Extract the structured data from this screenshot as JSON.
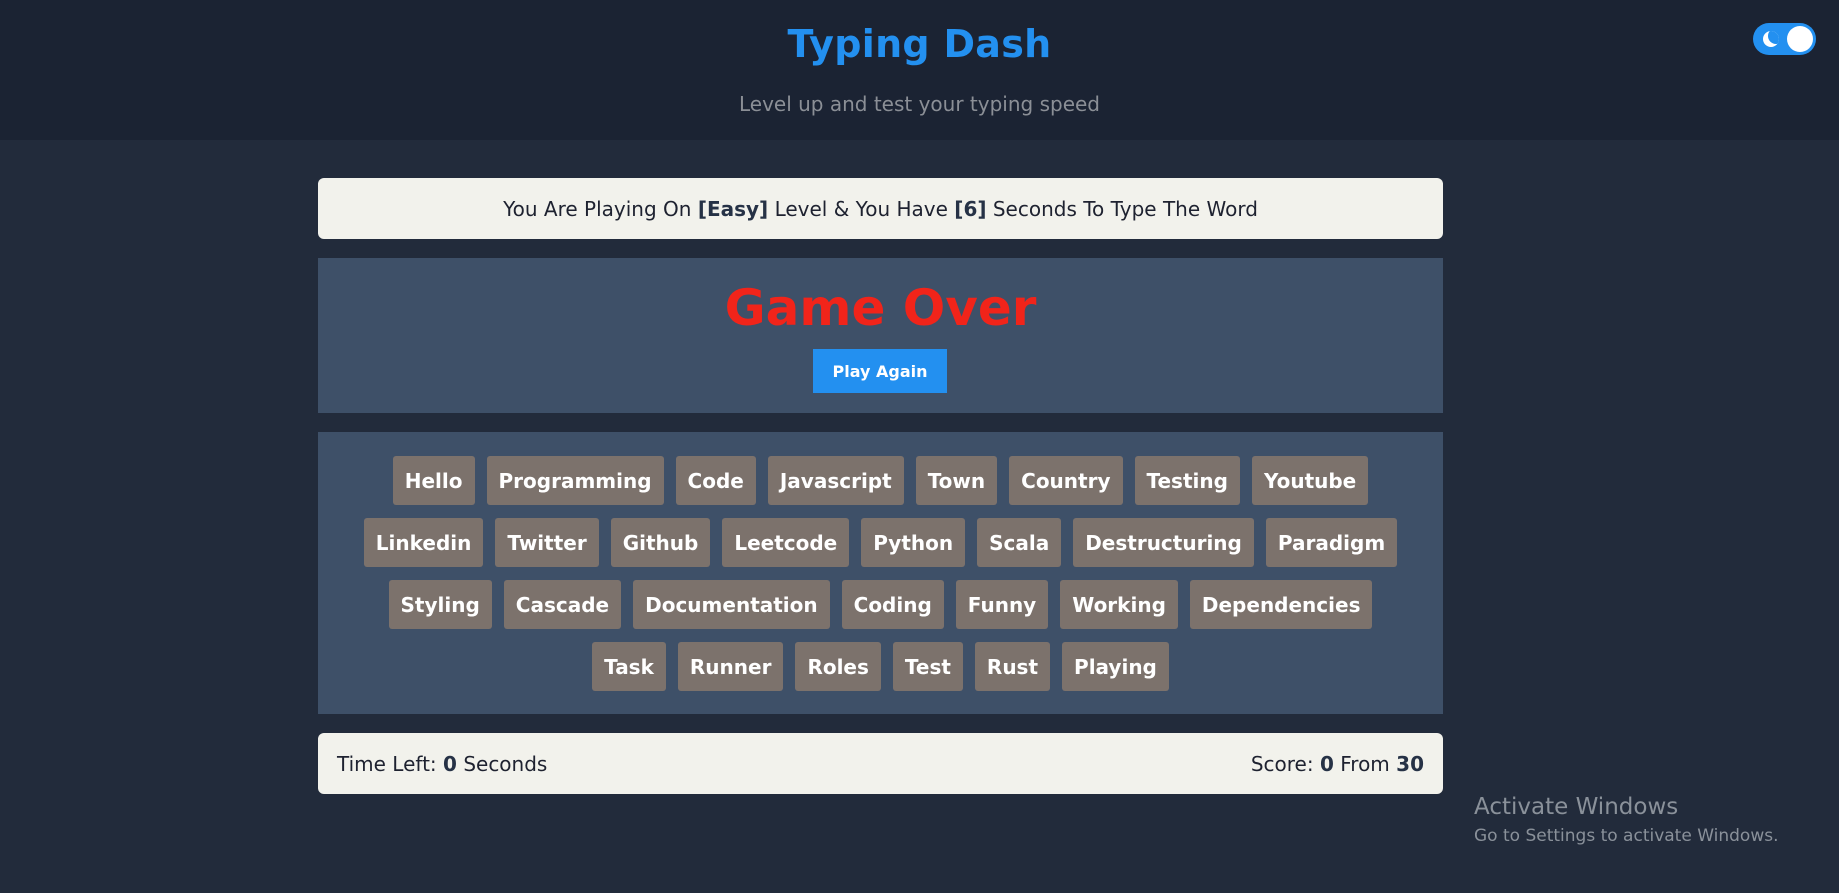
{
  "header": {
    "title": "Typing Dash",
    "subtitle": "Level up and test your typing speed"
  },
  "theme_toggle": {
    "icon": "moon-icon",
    "state": "on",
    "color": "#2390f0"
  },
  "message": {
    "prefix": "You Are Playing On",
    "level": "[Easy]",
    "middle": "Level & You Have",
    "seconds": "[6]",
    "suffix": "Seconds To Type The Word"
  },
  "game": {
    "status": "Game Over",
    "status_color": "#f1241a",
    "play_again_label": "Play Again"
  },
  "words": [
    "Hello",
    "Programming",
    "Code",
    "Javascript",
    "Town",
    "Country",
    "Testing",
    "Youtube",
    "Linkedin",
    "Twitter",
    "Github",
    "Leetcode",
    "Python",
    "Scala",
    "Destructuring",
    "Paradigm",
    "Styling",
    "Cascade",
    "Documentation",
    "Coding",
    "Funny",
    "Working",
    "Dependencies",
    "Task",
    "Runner",
    "Roles",
    "Test",
    "Rust",
    "Playing"
  ],
  "control": {
    "time_label": "Time Left:",
    "time_value": "0",
    "time_unit": "Seconds",
    "score_label": "Score:",
    "score_value": "0",
    "score_from_label": "From",
    "score_total": "30"
  },
  "watermark": {
    "title": "Activate Windows",
    "subtitle": "Go to Settings to activate Windows."
  }
}
